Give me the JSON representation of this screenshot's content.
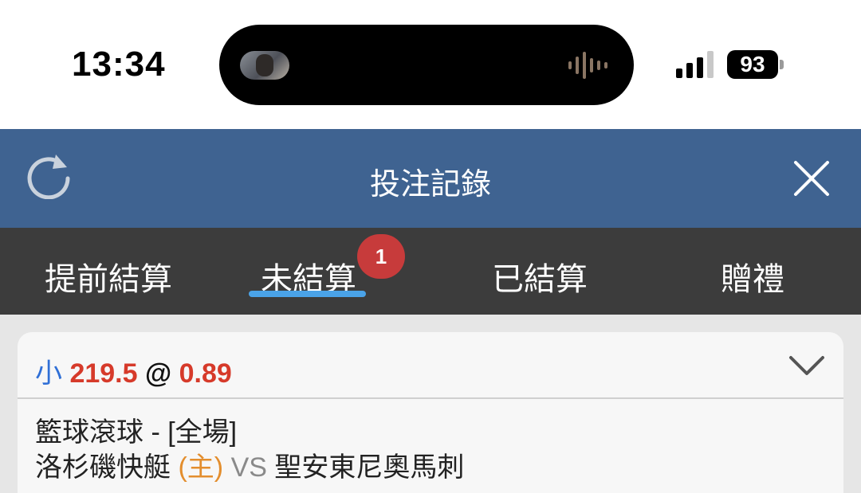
{
  "status_bar": {
    "time": "13:34",
    "battery": "93",
    "icons": [
      "media-thumbnail-icon",
      "audio-waveform-icon",
      "signal-bars-icon",
      "battery-icon"
    ]
  },
  "header": {
    "title": "投注記錄",
    "left_icon": "refresh-icon",
    "right_icon": "close-icon",
    "background": "#3f6391"
  },
  "tabs": {
    "items": [
      {
        "label": "提前結算"
      },
      {
        "label": "未結算",
        "badge": "1",
        "active": true
      },
      {
        "label": "已結算"
      },
      {
        "label": "贈禮"
      }
    ],
    "active_color": "#4aa3e8",
    "badge_color": "#c73b3b"
  },
  "bet": {
    "side": "小",
    "line": "219.5",
    "at": "@",
    "odds": "0.89",
    "expand_icon": "chevron-down-icon",
    "market": "籃球滾球 - [全場]",
    "home_team": "洛杉磯快艇",
    "home_tag": "(主)",
    "vs": "VS",
    "away_team": "聖安東尼奧馬刺"
  }
}
